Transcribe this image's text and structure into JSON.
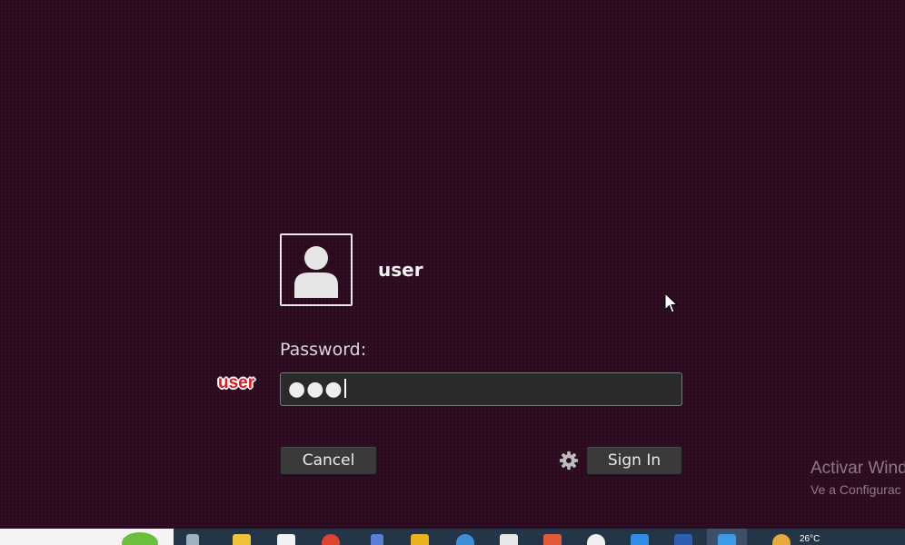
{
  "login": {
    "username": "user",
    "password_label": "Password:",
    "password_masked": "●●●",
    "cancel_label": "Cancel",
    "signin_label": "Sign In",
    "settings_icon": "gear-icon",
    "avatar_icon": "user-avatar-icon"
  },
  "overlay": {
    "label": "user"
  },
  "watermark": {
    "line1": "Activar Wind",
    "line2": "Ve a Configurac"
  },
  "taskbar": {
    "weather_temp": "26°C"
  },
  "colors": {
    "background": "#2c0a20",
    "input_bg": "#2a2a2a",
    "button_bg": "#3a3a3a",
    "overlay_text": "#e8141e",
    "taskbar": "#243548"
  }
}
